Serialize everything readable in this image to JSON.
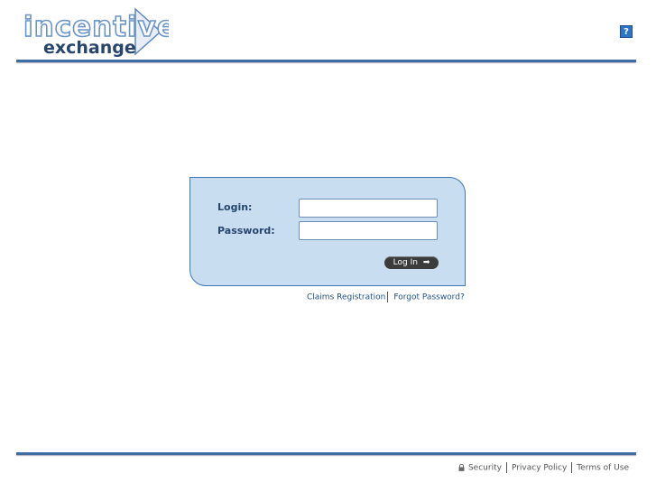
{
  "header": {
    "logo_line1": "incentive",
    "logo_line2": "exchange",
    "help_label": "?"
  },
  "login_form": {
    "login_label": "Login:",
    "password_label": "Password:",
    "login_value": "",
    "password_value": "",
    "submit_label": "Log In",
    "submit_arrow": "➡"
  },
  "links": {
    "claims_registration": "Claims Registration",
    "forgot_password": "Forgot Password?"
  },
  "footer": {
    "security": "Security",
    "privacy_policy": "Privacy Policy",
    "terms_of_use": "Terms of Use"
  },
  "colors": {
    "accent": "#3d6da3",
    "panel_bg": "#c9ddf0",
    "link": "#1f4f86"
  },
  "icons": {
    "help": "help-icon",
    "lock": "lock-icon",
    "arrow": "right-arrow-icon"
  }
}
